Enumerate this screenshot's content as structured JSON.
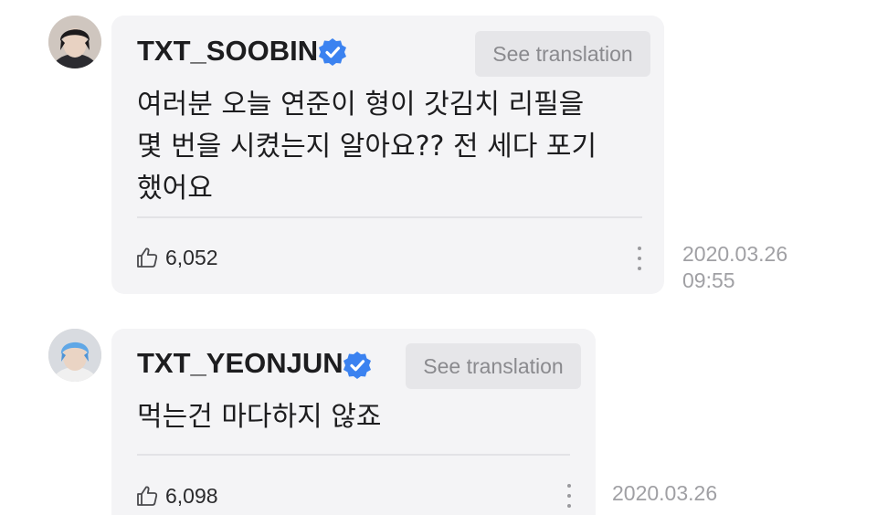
{
  "comments": [
    {
      "username": "TXT_SOOBIN",
      "verified": true,
      "translate_label": "See translation",
      "message": "여러분 오늘 연준이 형이 갓김치 리필을\n몇 번을 시켰는지 알아요?? 전 세다 포기\n했어요",
      "likes": "6,052",
      "date": "2020.03.26",
      "time": "09:55"
    },
    {
      "username": "TXT_YEONJUN",
      "verified": true,
      "translate_label": "See translation",
      "message": "먹는건 마다하지 않죠",
      "likes": "6,098",
      "date": "2020.03.26"
    }
  ],
  "colors": {
    "bubble": "#f4f4f6",
    "verified_badge": "#3b82f0",
    "text": "#1d1d1f",
    "muted": "#a0a0a4"
  },
  "icons": {
    "verified": "verified-badge-icon",
    "like": "thumbs-up-icon",
    "more": "more-vertical-icon"
  }
}
